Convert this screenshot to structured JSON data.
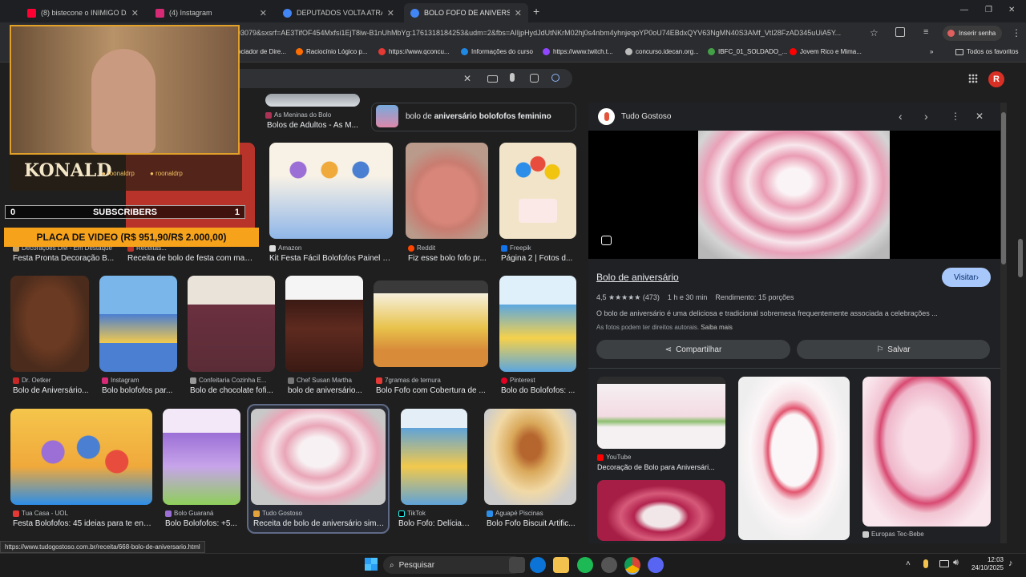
{
  "tabs": [
    {
      "title": "(8) bistecone o INIMIGO DA TIN",
      "color": "#ff0033"
    },
    {
      "title": "(4) Instagram",
      "color": "#d62976"
    },
    {
      "title": "DEPUTADOS VOLTA ATRAS CN",
      "color": "#4285f4"
    },
    {
      "title": "BOLO FOFO DE ANIVERSÁRIO",
      "color": "#4285f4"
    }
  ],
  "window": {
    "new_tab": "+",
    "minimize": "—",
    "maximize": "❐",
    "close": "✕"
  },
  "address": {
    "url": "293079&sxsrf=AE3TifOF454Mxfsi1EjT8iw-B1nUhMbYg:1761318184253&udm=2&fbs=AIIjpHydJdUtNKrM02hj0s4nbm4yhnjeqoYP0oU74EBdxQYV63NgMN40S3AMf_VtI28FzAD345uUiA5Y...",
    "password_chip": "Inserir senha"
  },
  "bookmarks": [
    {
      "label": "ociador de Dire...",
      "color": "#888"
    },
    {
      "label": "Raciocínio Lógico p...",
      "color": "#ff6d00"
    },
    {
      "label": "https://www.qconcu...",
      "color": "#e53935"
    },
    {
      "label": "Informações do curso",
      "color": "#1e88e5"
    },
    {
      "label": "https://www.twitch.t...",
      "color": "#9146ff"
    },
    {
      "label": "concurso.idecan.org...",
      "color": "#bbb"
    },
    {
      "label": "IBFC_01_SOLDADO_...",
      "color": "#43a047"
    },
    {
      "label": "Jovem Rico e Mima...",
      "color": "#ff0000"
    },
    {
      "label": "Todos os favoritos",
      "color": "#bbb"
    }
  ],
  "google": {
    "account_initial": "R",
    "clear": "✕"
  },
  "related": {
    "prefix": "bolo de ",
    "bold": "aniversário bolofofos feminino"
  },
  "overlay": {
    "logo": "KONALD",
    "handle": "roonaldrp",
    "handle2": "roonaldrp",
    "subs_label": "SUBSCRIBERS",
    "subs_left": "0",
    "subs_right": "1",
    "goal": "PLACA DE VIDEO (R$ 951,90/R$ 2.000,00)"
  },
  "rows": [
    [
      {
        "source": "Decorações DM - Em Destaque",
        "caption": "Festa Pronta Decoração B...",
        "color": "#c4a572"
      },
      {
        "source": "Receitas...",
        "caption": "Receita de bolo de festa com mas...",
        "color": "#b8342a"
      },
      {
        "source": "Amazon",
        "caption": "Kit Festa Fácil Bolofofos Painel B...",
        "color": "#8fb6e8"
      },
      {
        "source": "Reddit",
        "caption": "Fiz esse bolo fofo pr...",
        "color": "#d9867a"
      },
      {
        "source": "Freepik",
        "caption": "Página 2 | Fotos d...",
        "color": "#f2e4c9"
      }
    ],
    [
      {
        "source": "Dr. Oetker",
        "caption": "Bolo de Aniversário...",
        "color": "#4a2b1c"
      },
      {
        "source": "Instagram",
        "caption": "Bolo bolofofos par...",
        "color": "#4b7fd1"
      },
      {
        "source": "Confeitaria Cozinha E...",
        "caption": "Bolo de chocolate fofi...",
        "color": "#5a2c36"
      },
      {
        "source": "Chef Susan Martha",
        "caption": "bolo de aniversário...",
        "color": "#3b1a14"
      },
      {
        "source": "7gramas de ternura",
        "caption": "Bolo Fofo com Cobertura de ...",
        "color": "#e8c24b"
      },
      {
        "source": "Pinterest",
        "caption": "Bolo do Bolofofos: ...",
        "color": "#5ba7e0"
      }
    ],
    [
      {
        "source": "Tua Casa - UOL",
        "caption": "Festa Bolofofos: 45 ideias para te enc...",
        "color": "#f0a93b"
      },
      {
        "source": "Bolo Guaraná",
        "caption": "Bolo Bolofofos: +5...",
        "color": "#9b6fd6"
      },
      {
        "source": "Tudo Gostoso",
        "caption": "Receita de bolo de aniversário simp...",
        "color": "#e9a6b8"
      },
      {
        "source": "TikTok",
        "caption": "Bolo Fofo: Delícias...",
        "color": "#5fa3d8"
      },
      {
        "source": "Aguapé Piscinas",
        "caption": "Bolo Fofo Biscuit Artific...",
        "color": "#d9a85a"
      }
    ]
  ],
  "top_strip": {
    "source": "As Meninas do Bolo",
    "caption": "Bolos de Adultos - As M..."
  },
  "panel": {
    "site": "Tudo Gostoso",
    "title": "Bolo de aniversário",
    "visit": "Visitar",
    "rating": "4,5 ★★★★★ (473)",
    "time": "1 h e 30 min",
    "yield": "Rendimento: 15 porções",
    "desc": "O bolo de aniversário é uma deliciosa e tradicional sobremesa frequentemente associada a celebrações ...",
    "rights": "As fotos podem ter direitos autorais.",
    "more": "Saiba mais",
    "share": "Compartilhar",
    "save": "Salvar",
    "related": [
      {
        "source": "YouTube",
        "caption": "Decoração de Bolo para Aniversári..."
      },
      {
        "source": "Europas Tec-Bebe",
        "caption": ""
      }
    ]
  },
  "status_url": "https://www.tudogostoso.com.br/receita/668-bolo-de-aniversario.html",
  "taskbar": {
    "search": "Pesquisar",
    "time": "12:03",
    "date": "24/10/2025"
  }
}
